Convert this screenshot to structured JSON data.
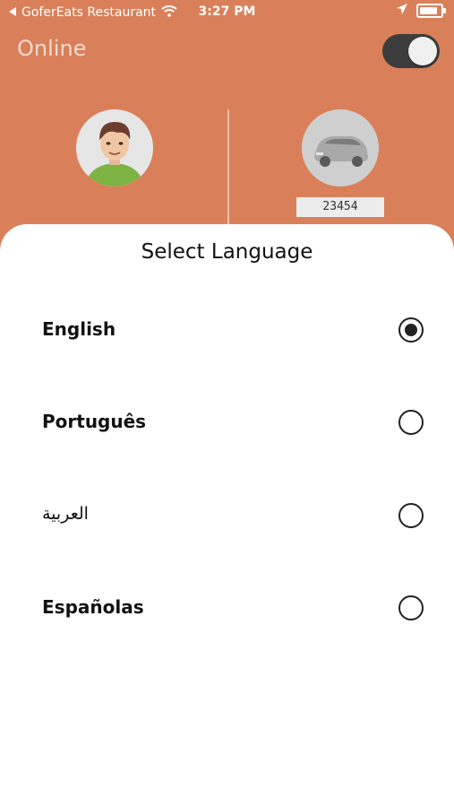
{
  "status_bar": {
    "back_app": "GoferEats Restaurant",
    "time": "3:27 PM"
  },
  "header": {
    "status_label": "Online",
    "online_toggle_on": true
  },
  "vehicle": {
    "plate_number": "23454"
  },
  "language_sheet": {
    "title": "Select Language",
    "options": [
      {
        "label": "English",
        "selected": true
      },
      {
        "label": "Português",
        "selected": false
      },
      {
        "label": "العربية",
        "selected": false
      },
      {
        "label": "Españolas",
        "selected": false
      }
    ]
  },
  "colors": {
    "header_bg": "#d9805a",
    "toggle_bg": "#3c3c3c"
  },
  "icons": [
    "back-arrow-icon",
    "wifi-icon",
    "location-arrow-icon",
    "battery-icon",
    "radio-selected-icon",
    "radio-unselected-icon"
  ]
}
